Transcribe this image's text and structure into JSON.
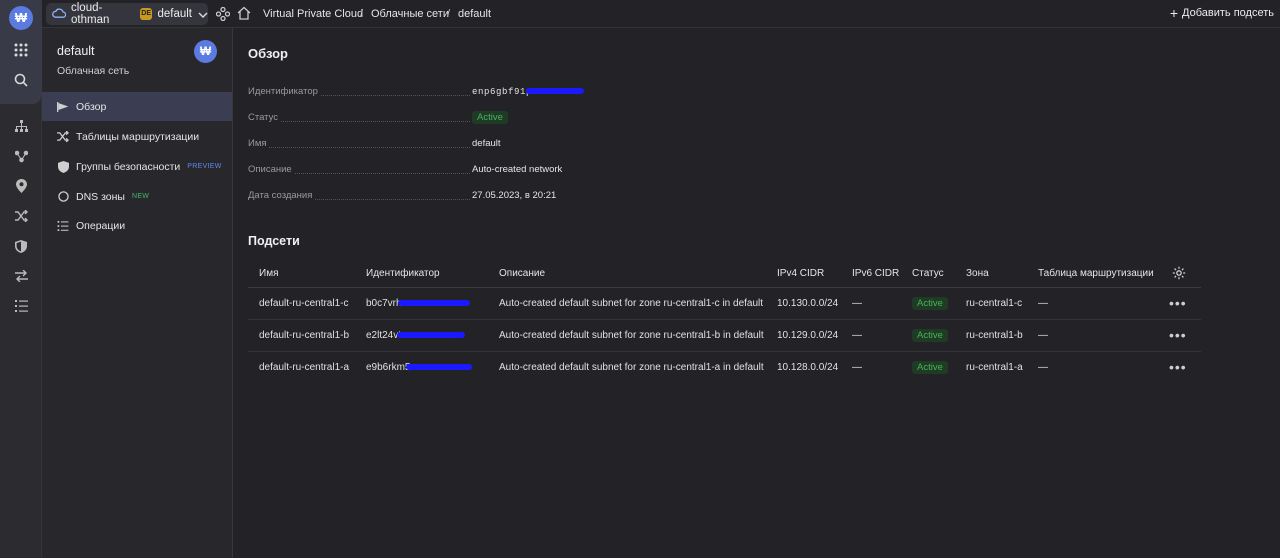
{
  "rail": {
    "logo": "₩",
    "icons": [
      "apps-grid-icon",
      "search-icon",
      "network-tree-icon",
      "nodes-icon",
      "location-pin-icon",
      "shuffle-icon",
      "shield-icon",
      "arrows-icon",
      "list-icon"
    ]
  },
  "topbar": {
    "cloud": "cloud-othman",
    "folder_badge": "DE",
    "folder": "default",
    "breadcrumbs": [
      "Virtual Private Cloud",
      "Облачные сети",
      "default"
    ],
    "separators": [
      "/",
      "/"
    ],
    "add_subnet": "Добавить подсеть"
  },
  "sidepanel": {
    "title": "default",
    "subtitle": "Облачная сеть",
    "avatar": "₩",
    "items": [
      {
        "label": "Обзор",
        "icon": "flag-icon",
        "active": true
      },
      {
        "label": "Таблицы маршрутизации",
        "icon": "shuffle-icon"
      },
      {
        "label": "Группы безопасности",
        "icon": "shield-icon",
        "tag": "PREVIEW"
      },
      {
        "label": "DNS зоны",
        "icon": "circle-icon",
        "tag": "NEW"
      },
      {
        "label": "Операции",
        "icon": "list-icon"
      }
    ]
  },
  "overview": {
    "title": "Обзор",
    "props": [
      {
        "label": "Идентификатор",
        "value": "enp6gbf91p"
      },
      {
        "label": "Статус",
        "value": "Active"
      },
      {
        "label": "Имя",
        "value": "default"
      },
      {
        "label": "Описание",
        "value": "Auto-created network"
      },
      {
        "label": "Дата создания",
        "value": "27.05.2023, в 20:21"
      }
    ]
  },
  "subnets": {
    "title": "Подсети",
    "columns": [
      "Имя",
      "Идентификатор",
      "Описание",
      "IPv4 CIDR",
      "IPv6 CIDR",
      "Статус",
      "Зона",
      "Таблица маршрутизации"
    ],
    "rows": [
      {
        "name": "default-ru-central1-c",
        "id": "b0c7vrh",
        "description": "Auto-created default subnet for zone ru-central1-c in default",
        "ipv4": "10.130.0.0/24",
        "ipv6": "—",
        "status": "Active",
        "zone": "ru-central1-c",
        "route_table": "—"
      },
      {
        "name": "default-ru-central1-b",
        "id": "e2lt24vt",
        "description": "Auto-created default subnet for zone ru-central1-b in default",
        "ipv4": "10.129.0.0/24",
        "ipv6": "—",
        "status": "Active",
        "zone": "ru-central1-b",
        "route_table": "—"
      },
      {
        "name": "default-ru-central1-a",
        "id": "e9b6rkm5",
        "description": "Auto-created default subnet for zone ru-central1-a in default",
        "ipv4": "10.128.0.0/24",
        "ipv6": "—",
        "status": "Active",
        "zone": "ru-central1-a",
        "route_table": "—"
      }
    ],
    "row_menu": "•••"
  },
  "colors": {
    "accent": "#5c7be0",
    "active_status": "#45b35a",
    "redaction": "#1a1aff"
  }
}
